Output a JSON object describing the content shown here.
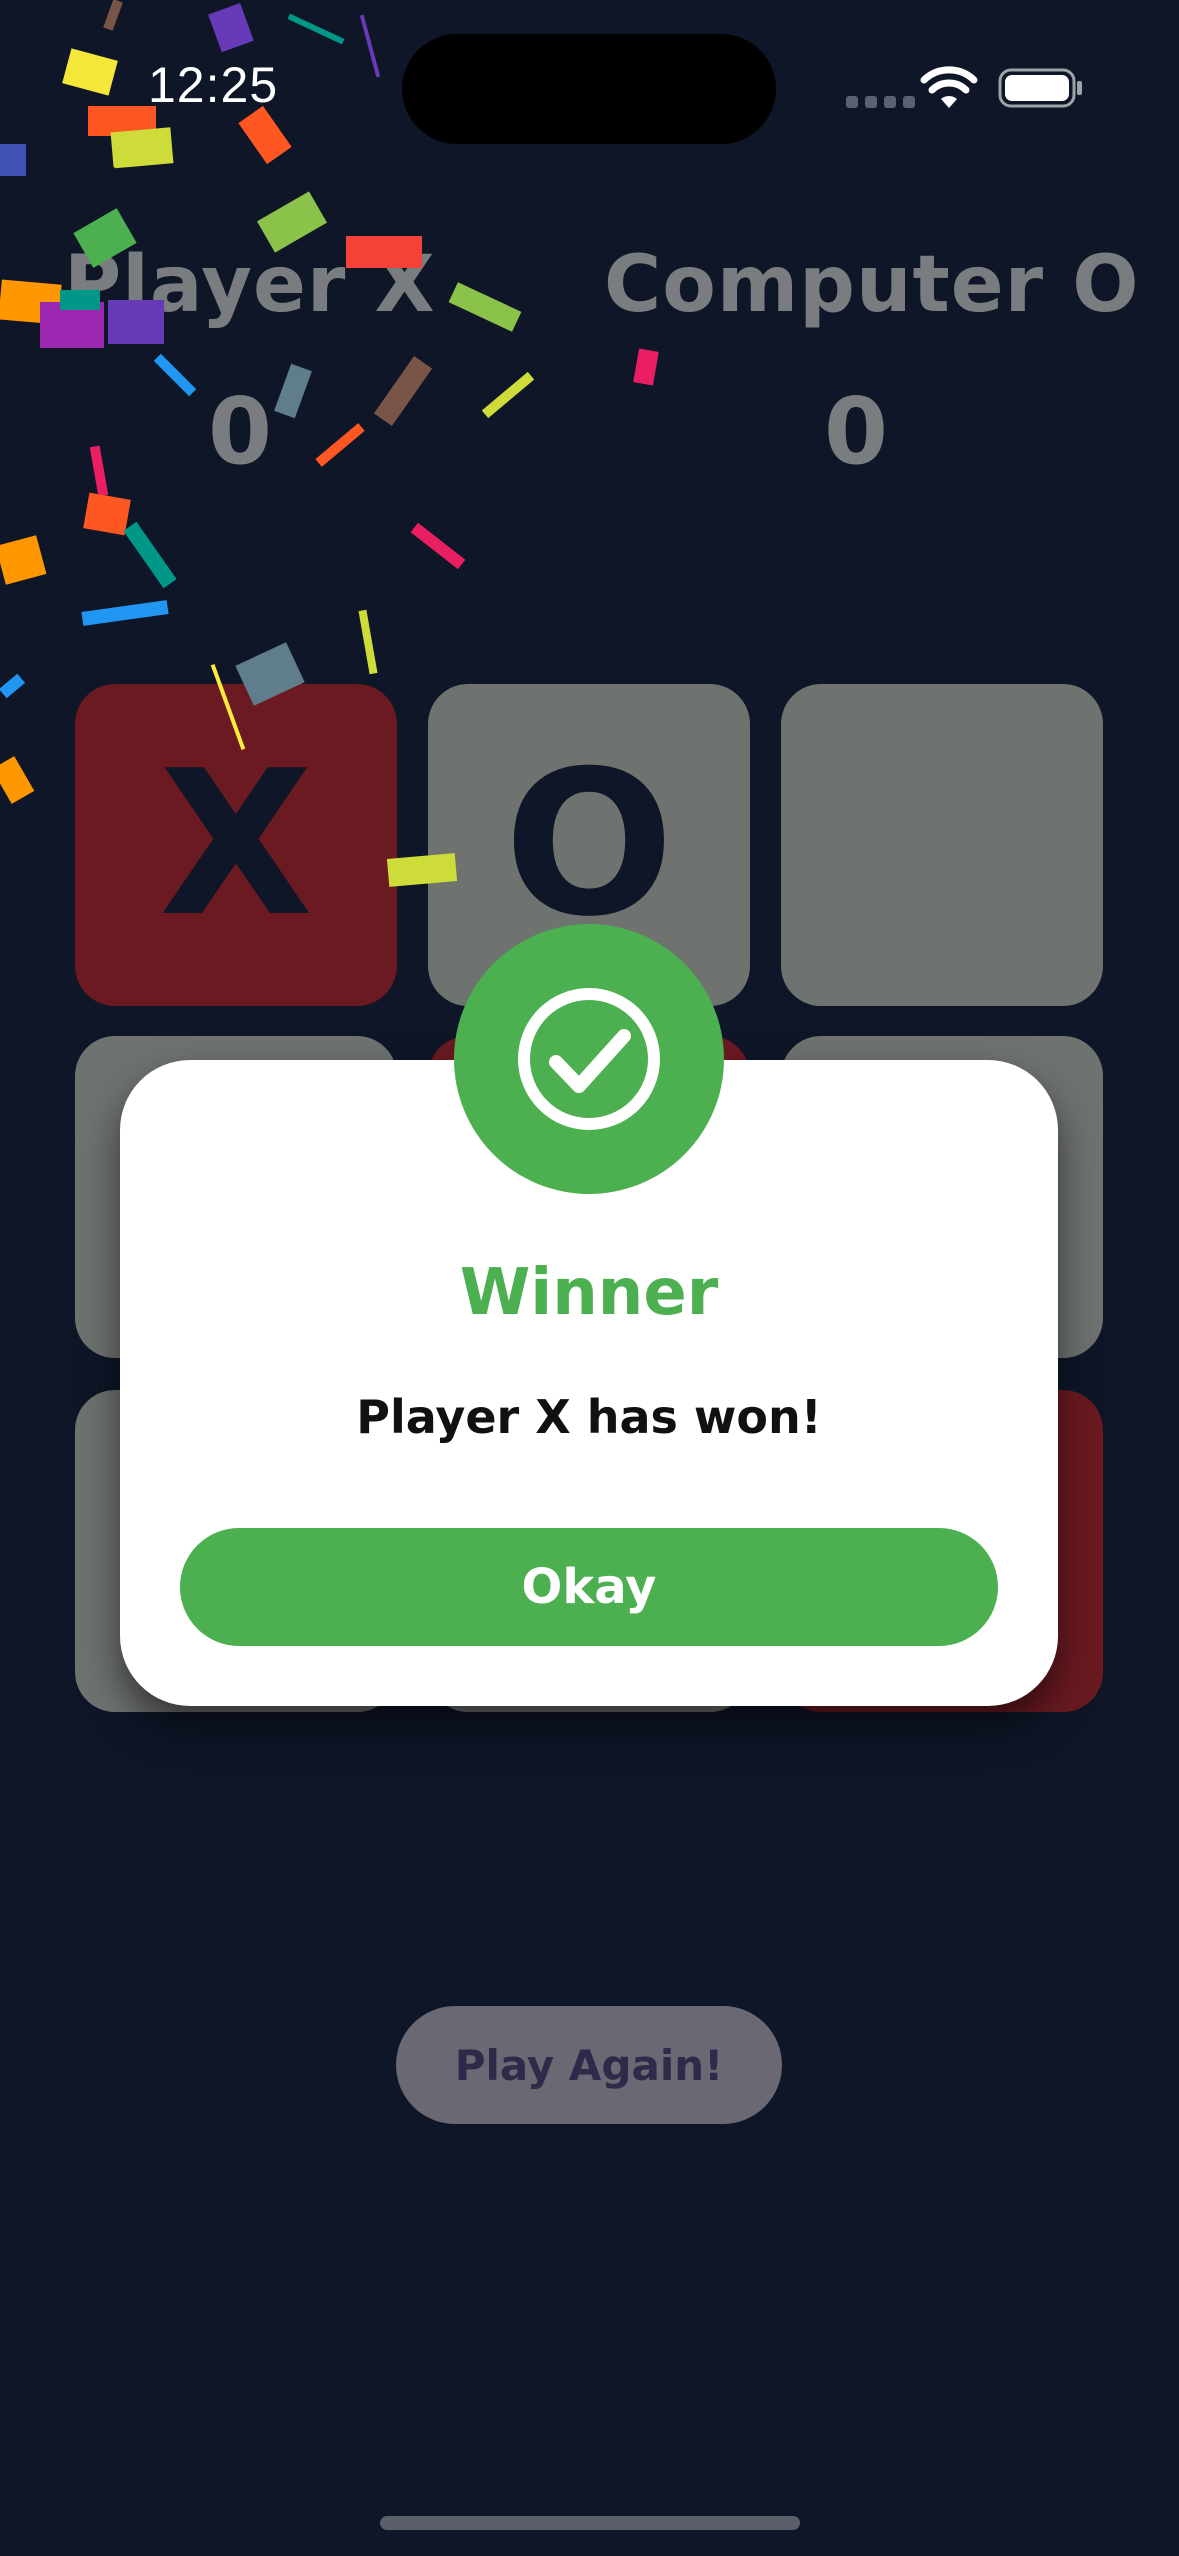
{
  "status_bar": {
    "time": "12:25"
  },
  "scoreboard": {
    "player_label": "Player X",
    "player_score": "0",
    "computer_label": "Computer O",
    "computer_score": "0"
  },
  "board": {
    "cells": [
      "X",
      "O",
      "",
      "",
      "",
      "",
      "",
      "",
      ""
    ]
  },
  "modal": {
    "title": "Winner",
    "message": "Player X has won!",
    "button_label": "Okay",
    "icon": "check-circle-icon"
  },
  "play_again_label": "Play Again!",
  "colors": {
    "background": "#0e1627",
    "accent_green": "#4caf50",
    "winning_cell": "#6b1a21",
    "empty_cell": "#6f7370"
  }
}
